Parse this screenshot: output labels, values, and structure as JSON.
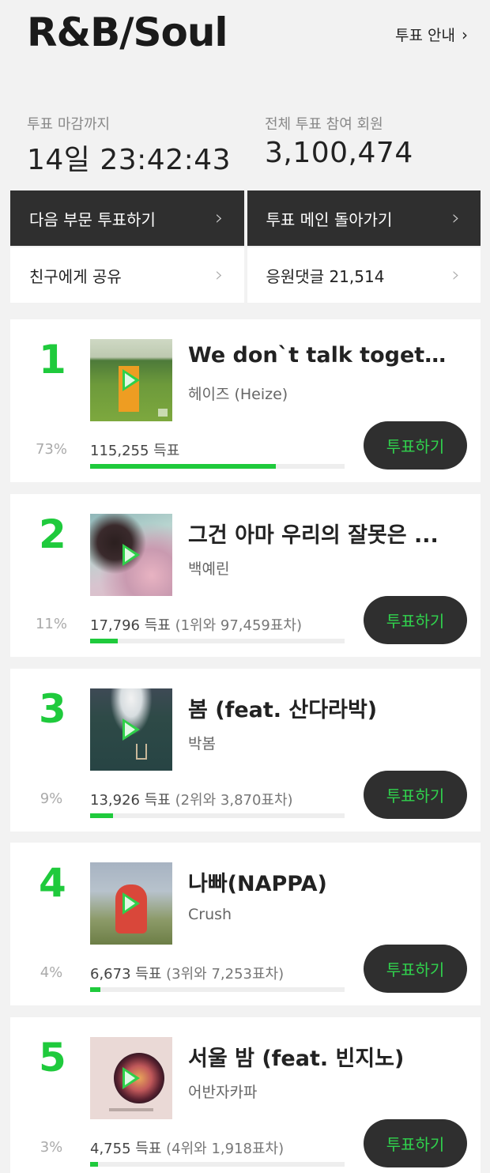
{
  "header": {
    "title": "R&B/Soul",
    "guide_label": "투표 안내",
    "guide_icon": "chevron-right-icon"
  },
  "stats": {
    "deadline_label": "투표 마감까지",
    "deadline_value": "14일 23:42:43",
    "participants_label": "전체 투표 참여 회원",
    "participants_value": "3,100,474"
  },
  "actions": {
    "next_category": "다음 부문 투표하기",
    "main_vote": "투표 메인 돌아가기",
    "share": "친구에게 공유",
    "comments": "응원댓글 21,514"
  },
  "colors": {
    "accent": "#1fca3c",
    "dark_button": "#2f2f2f",
    "vote_text": "#30d34d"
  },
  "entries": [
    {
      "rank": "1",
      "title": "We don`t talk togethe...",
      "artist": "헤이즈 (Heize)",
      "percent_label": "73%",
      "percent": 73,
      "votes": "115,255",
      "votes_unit": "득표",
      "gap": "",
      "vote_button": "투표하기"
    },
    {
      "rank": "2",
      "title": "그건 아마 우리의 잘못은 ...",
      "artist": "백예린",
      "percent_label": "11%",
      "percent": 11,
      "votes": "17,796",
      "votes_unit": "득표",
      "gap": "(1위와 97,459표차)",
      "vote_button": "투표하기"
    },
    {
      "rank": "3",
      "title": "봄 (feat. 산다라박)",
      "artist": "박봄",
      "percent_label": "9%",
      "percent": 9,
      "votes": "13,926",
      "votes_unit": "득표",
      "gap": "(2위와 3,870표차)",
      "vote_button": "투표하기"
    },
    {
      "rank": "4",
      "title": "나빠(NAPPA)",
      "artist": "Crush",
      "percent_label": "4%",
      "percent": 4,
      "votes": "6,673",
      "votes_unit": "득표",
      "gap": "(3위와 7,253표차)",
      "vote_button": "투표하기"
    },
    {
      "rank": "5",
      "title": "서울 밤 (feat. 빈지노)",
      "artist": "어반자카파",
      "percent_label": "3%",
      "percent": 3,
      "votes": "4,755",
      "votes_unit": "득표",
      "gap": "(4위와 1,918표차)",
      "vote_button": "투표하기"
    }
  ]
}
